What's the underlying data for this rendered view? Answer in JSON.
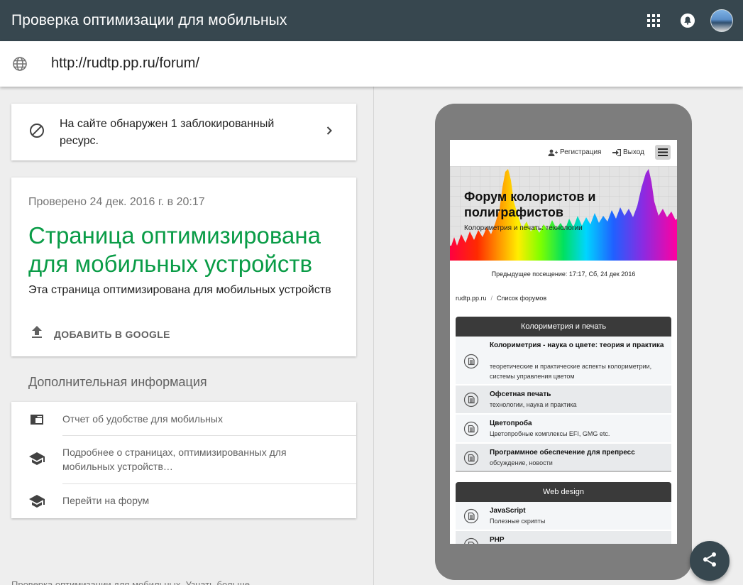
{
  "app": {
    "title": "Проверка оптимизации для мобильных"
  },
  "header_icons": [
    "apps-grid-icon",
    "notifications-icon",
    "avatar"
  ],
  "url": {
    "value": "http://rudtp.pp.ru/forum/"
  },
  "blocked": {
    "text": "На сайте обнаружен 1 заблокированный ресурс."
  },
  "result": {
    "checked": "Проверено 24 дек. 2016 г. в 20:17",
    "headline": "Страница оптимизирована для мобильных устройств",
    "description": "Эта страница оптимизирована для мобильных устройств",
    "add_button": "ДОБАВИТЬ В GOOGLE",
    "headline_color": "#0a9c47"
  },
  "more": {
    "heading": "Дополнительная информация",
    "items": [
      {
        "icon": "web-window-icon",
        "label": "Отчет об удобстве для мобильных"
      },
      {
        "icon": "school-icon",
        "label": "Подробнее о страницах, оптимизированных для мобильных устройств…"
      },
      {
        "icon": "school-icon",
        "label": "Перейти на форум"
      }
    ]
  },
  "footer": {
    "text": "Проверка оптимизации для мобильных. Узнать больше"
  },
  "preview": {
    "register": "Регистрация",
    "logout": "Выход",
    "forum_title": "Форум колористов и полиграфистов",
    "forum_subtitle": "Колориметрия и печать: технологии",
    "last_visit": "Предыдущее посещение: 17:17, Сб, 24 дек 2016",
    "breadcrumb": [
      "rudtp.pp.ru",
      "Список форумов"
    ],
    "sections": [
      {
        "title": "Колориметрия и печать",
        "forums": [
          {
            "name": "Колориметрия - наука о цвете: теория и практика",
            "desc": "теоретические и практические аспекты колориметрии, системы управления цветом"
          },
          {
            "name": "Офсетная печать",
            "desc": "технологии, наука и практика"
          },
          {
            "name": "Цветопроба",
            "desc": "Цветопробные комплексы EFI, GMG etc."
          },
          {
            "name": "Программное обеспечение для препресс",
            "desc": "обсуждение, новости"
          }
        ]
      },
      {
        "title": "Web design",
        "forums": [
          {
            "name": "JavaScript",
            "desc": "Полезные скрипты"
          },
          {
            "name": "PHP",
            "desc": ""
          }
        ]
      }
    ]
  },
  "colors": {
    "topbar": "#37474f",
    "success": "#0a9c47",
    "phone_frame": "#7d7d7d"
  }
}
